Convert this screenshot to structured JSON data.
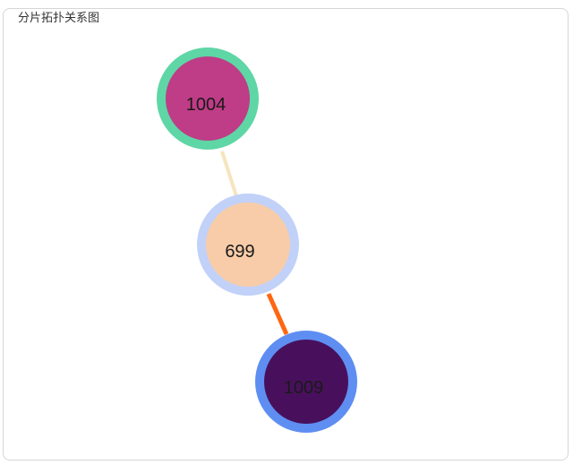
{
  "panel": {
    "title": "分片拓扑关系图"
  },
  "graph": {
    "nodes": [
      {
        "id": "1004",
        "label": "1004",
        "fill": "#bf3c87",
        "ring": "#5ed6a5"
      },
      {
        "id": "699",
        "label": "699",
        "fill": "#f8cca8",
        "ring": "#c1d1f8"
      },
      {
        "id": "1009",
        "label": "1009",
        "fill": "#48105c",
        "ring": "#5f8ef2"
      }
    ],
    "edges": [
      {
        "source": "1004",
        "target": "699",
        "color": "#f6e5bd"
      },
      {
        "source": "699",
        "target": "1009",
        "color": "#ff6613"
      }
    ]
  }
}
